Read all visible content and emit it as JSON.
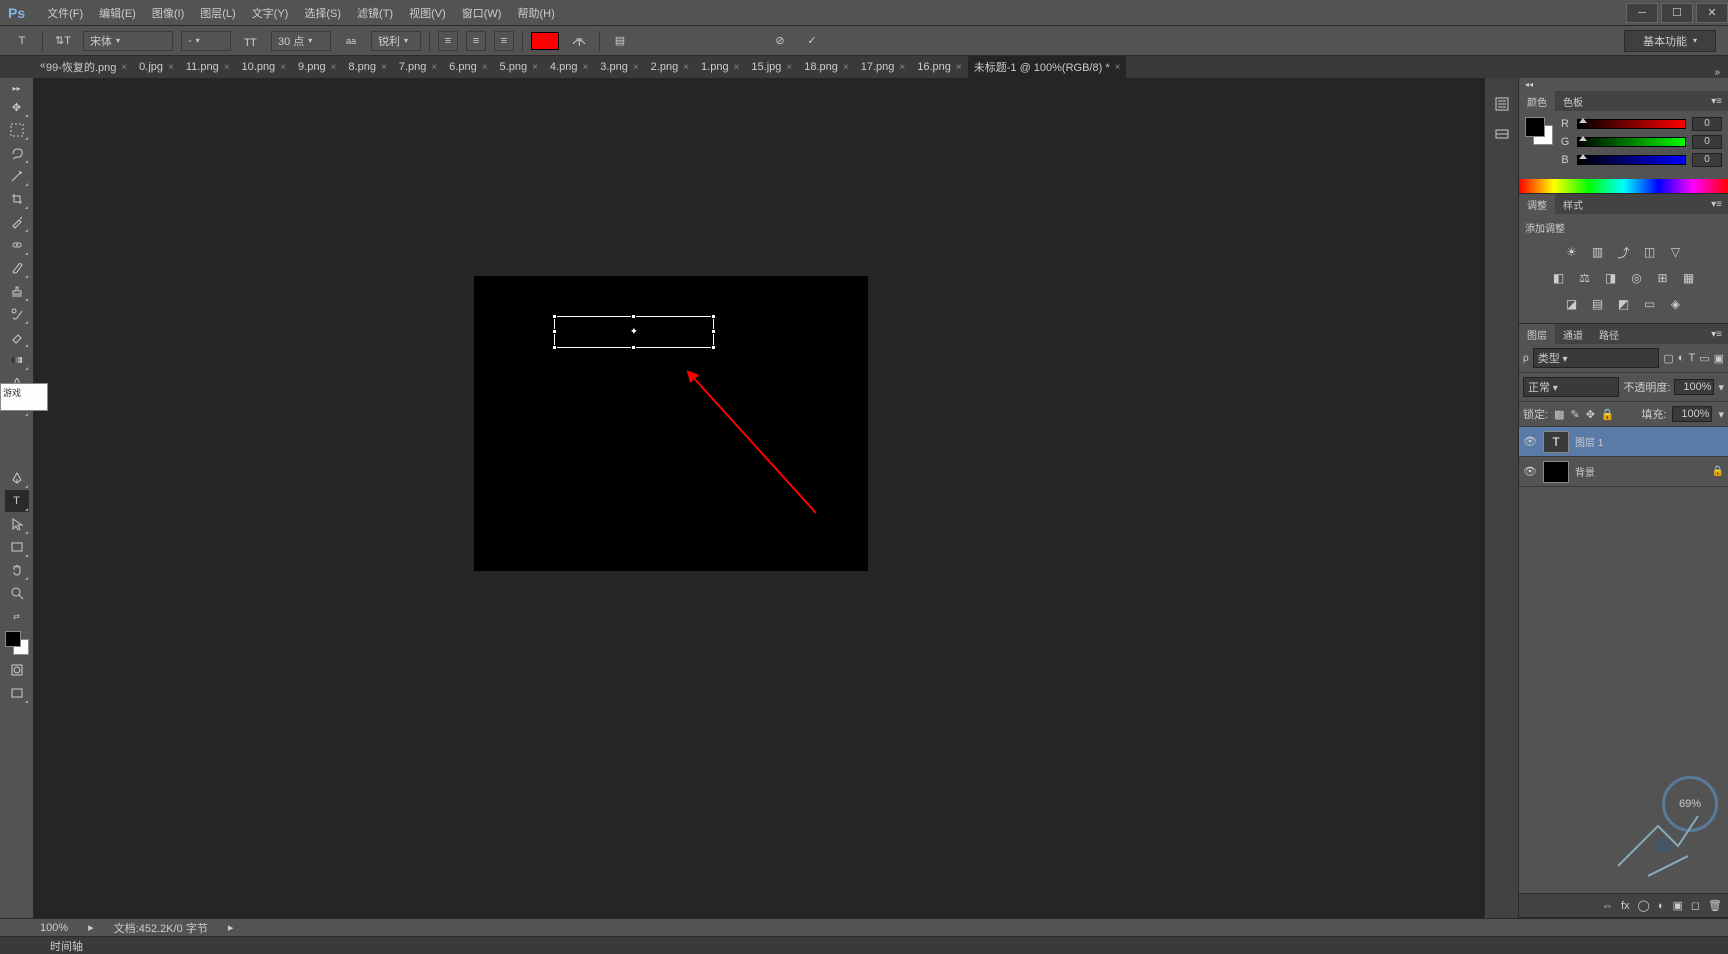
{
  "app": {
    "logo": "Ps"
  },
  "menu": [
    "文件(F)",
    "编辑(E)",
    "图像(I)",
    "图层(L)",
    "文字(Y)",
    "选择(S)",
    "滤镜(T)",
    "视图(V)",
    "窗口(W)",
    "帮助(H)"
  ],
  "options": {
    "font": "宋体",
    "style": "-",
    "size": "30 点",
    "aa_label": "锐利",
    "color": "#ff0000",
    "workspace": "基本功能"
  },
  "tabs": [
    {
      "label": "99-恢复的.png",
      "active": false
    },
    {
      "label": "0.jpg",
      "active": false
    },
    {
      "label": "11.png",
      "active": false
    },
    {
      "label": "10.png",
      "active": false
    },
    {
      "label": "9.png",
      "active": false
    },
    {
      "label": "8.png",
      "active": false
    },
    {
      "label": "7.png",
      "active": false
    },
    {
      "label": "6.png",
      "active": false
    },
    {
      "label": "5.png",
      "active": false
    },
    {
      "label": "4.png",
      "active": false
    },
    {
      "label": "3.png",
      "active": false
    },
    {
      "label": "2.png",
      "active": false
    },
    {
      "label": "1.png",
      "active": false
    },
    {
      "label": "15.jpg",
      "active": false
    },
    {
      "label": "18.png",
      "active": false
    },
    {
      "label": "17.png",
      "active": false
    },
    {
      "label": "16.png",
      "active": false
    },
    {
      "label": "未标题-1 @ 100%(RGB/8) *",
      "active": true
    }
  ],
  "tooltip": "游戏",
  "status": {
    "zoom": "100%",
    "doc": "文档:452.2K/0 字节"
  },
  "timeline_label": "时间轴",
  "panels": {
    "color": {
      "tabs": [
        "颜色",
        "色板"
      ],
      "r": "0",
      "g": "0",
      "b": "0",
      "labels": {
        "r": "R",
        "g": "G",
        "b": "B"
      }
    },
    "adjustments": {
      "tabs": [
        "调整",
        "样式"
      ],
      "add_label": "添加调整"
    },
    "layers": {
      "tabs": [
        "图层",
        "通道",
        "路径"
      ],
      "type_label": "类型",
      "blend": "正常",
      "opacity_label": "不透明度:",
      "opacity": "100%",
      "fill_label": "填充:",
      "fill": "100%",
      "lock_label": "锁定:",
      "items": [
        {
          "name": "图层 1",
          "type": "text",
          "selected": true
        },
        {
          "name": "背景",
          "type": "bg",
          "selected": false,
          "locked": true
        }
      ]
    }
  },
  "deco_pct": "69%"
}
